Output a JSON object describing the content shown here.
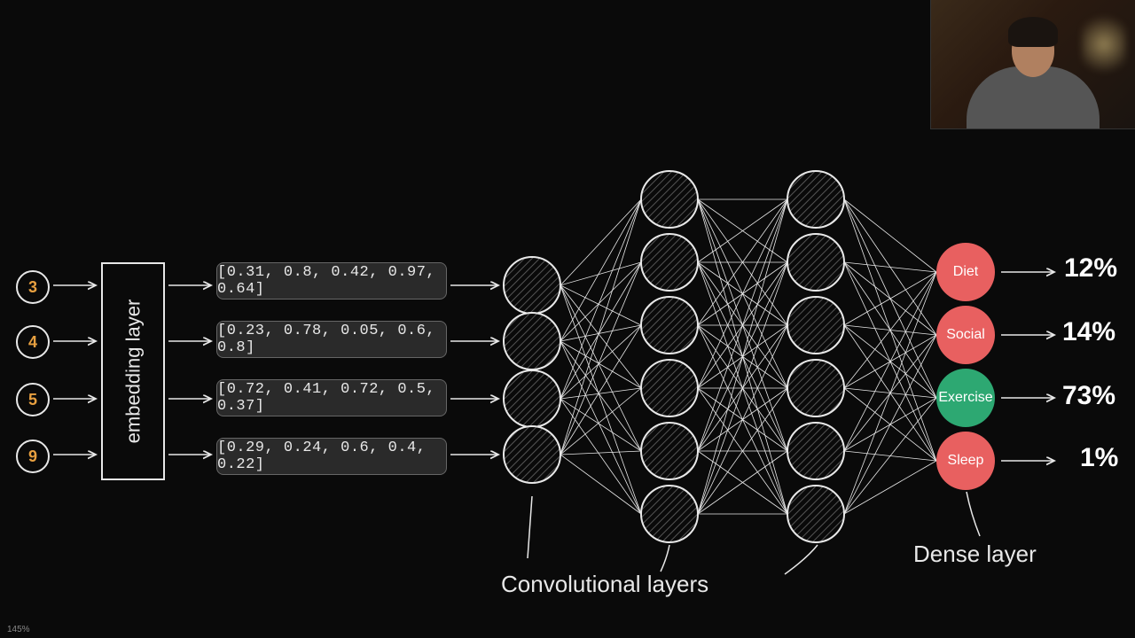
{
  "inputs": [
    "3",
    "4",
    "5",
    "9"
  ],
  "embedding_label": "embedding layer",
  "vectors": [
    "[0.31, 0.8, 0.42, 0.97, 0.64]",
    "[0.23, 0.78, 0.05, 0.6, 0.8]",
    "[0.72, 0.41, 0.72, 0.5, 0.37]",
    "[0.29, 0.24, 0.6, 0.4, 0.22]"
  ],
  "outputs": [
    {
      "label": "Diet",
      "pct": "12%",
      "color": "red"
    },
    {
      "label": "Social",
      "pct": "14%",
      "color": "red"
    },
    {
      "label": "Exercise",
      "pct": "73%",
      "color": "green"
    },
    {
      "label": "Sleep",
      "pct": "1%",
      "color": "red"
    }
  ],
  "conv_label": "Convolutional layers",
  "dense_label": "Dense layer",
  "zoom": "145%",
  "layers": {
    "l1": 4,
    "l2": 6,
    "l3": 6,
    "l4": 4
  }
}
